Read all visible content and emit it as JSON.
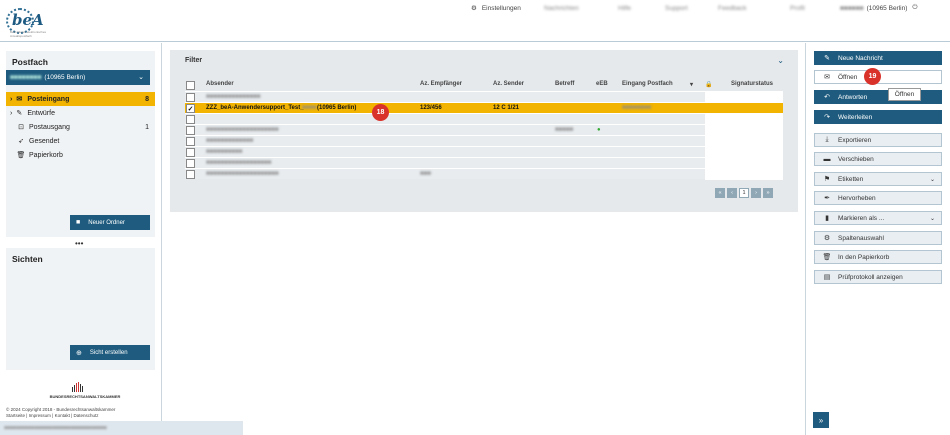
{
  "header": {
    "logo_text": "beA",
    "logo_sub": "Besonderes elektronisches Anwaltspostfach",
    "settings_label": "Einstellungen",
    "blurred_items": [
      "Nachrichten",
      "Hilfe",
      "Support",
      "Feedback",
      "Profil"
    ],
    "user_suffix": "(10965 Berlin)"
  },
  "sidebar": {
    "postfach_title": "Postfach",
    "postfach_select": "(10965 Berlin)",
    "folders": [
      {
        "label": "Posteingang",
        "count": "8",
        "icon": "envelope-icon"
      },
      {
        "label": "Entwürfe",
        "count": "",
        "icon": "edit-icon"
      },
      {
        "label": "Postausgang",
        "count": "1",
        "icon": "outbox-icon"
      },
      {
        "label": "Gesendet",
        "count": "",
        "icon": "send-icon"
      },
      {
        "label": "Papierkorb",
        "count": "",
        "icon": "trash-icon"
      }
    ],
    "new_folder_label": "Neuer Ordner",
    "sichten_title": "Sichten",
    "new_view_label": "Sicht erstellen",
    "bak_logo": "BUNDESRECHTSANWALTSKAMMER",
    "copyright": "© 2024 Copyright 2018 - Bundesrechtsanwaltskammer",
    "footer_links": "Startseite | Impressum | Kontakt | Datenschutz"
  },
  "main": {
    "filter_label": "Filter",
    "columns": [
      "Absender",
      "Az. Empfänger",
      "Az. Sender",
      "Betreff",
      "eEB",
      "Eingang Postfach",
      "",
      "Signaturstatus"
    ],
    "selected_row": {
      "absender": "ZZZ_beA-Anwendersupport_Test_",
      "absender_suffix": "(10965 Berlin)",
      "az_empfaenger": "123/456",
      "az_sender": "12 C 1/21"
    },
    "pager_current": "1"
  },
  "actions": [
    {
      "label": "Neue Nachricht",
      "icon": "pencil-icon",
      "style": "dark"
    },
    {
      "label": "Öffnen",
      "icon": "envelope-icon",
      "style": "white"
    },
    {
      "label": "Antworten",
      "icon": "reply-icon",
      "style": "dark"
    },
    {
      "label": "Weiterleiten",
      "icon": "forward-icon",
      "style": "dark"
    },
    {
      "label": "Exportieren",
      "icon": "download-icon",
      "style": "light"
    },
    {
      "label": "Verschieben",
      "icon": "folder-icon",
      "style": "light"
    },
    {
      "label": "Etiketten",
      "icon": "tag-icon",
      "style": "light"
    },
    {
      "label": "Hervorheben",
      "icon": "pen-icon",
      "style": "light"
    },
    {
      "label": "Markieren als ...",
      "icon": "bookmark-icon",
      "style": "light"
    },
    {
      "label": "Spaltenauswahl",
      "icon": "gear-icon",
      "style": "light"
    },
    {
      "label": "In den Papierkorb",
      "icon": "trash-icon",
      "style": "light"
    },
    {
      "label": "Prüfprotokoll anzeigen",
      "icon": "document-icon",
      "style": "light"
    }
  ],
  "tooltip": "Öffnen",
  "badges": {
    "row": "18",
    "open": "19"
  },
  "colors": {
    "primary": "#1e5b7e",
    "highlight": "#f2b400",
    "badge": "#d9322b"
  }
}
